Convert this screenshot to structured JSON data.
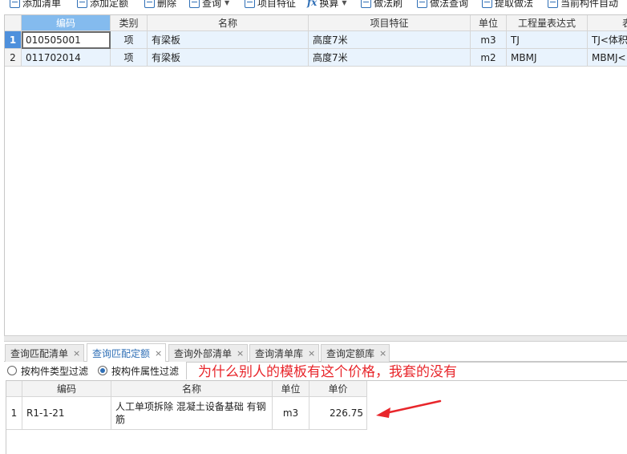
{
  "toolbar": {
    "items": [
      {
        "label": "添加清单",
        "icon": "add-list-icon"
      },
      {
        "label": "添加定额",
        "icon": "add-quota-icon"
      },
      {
        "label": "删除",
        "icon": "delete-icon"
      },
      {
        "label": "查询",
        "icon": "query-icon"
      },
      {
        "label": "项目特征",
        "icon": "feature-icon"
      },
      {
        "label": "换算",
        "icon": "fx-icon"
      },
      {
        "label": "做法刷",
        "icon": "brush-icon"
      },
      {
        "label": "做法查询",
        "icon": "method-query-icon"
      },
      {
        "label": "提取做法",
        "icon": "extract-icon"
      },
      {
        "label": "当前构件自动",
        "icon": "auto-icon"
      }
    ]
  },
  "main_grid": {
    "headers": [
      "编码",
      "类别",
      "名称",
      "项目特征",
      "单位",
      "工程量表达式",
      "表"
    ],
    "rows": [
      {
        "num": "1",
        "code": "010505001",
        "type": "项",
        "name": "有梁板",
        "feature": "高度7米",
        "unit": "m3",
        "expr": "TJ",
        "expr2": "TJ<体积"
      },
      {
        "num": "2",
        "code": "011702014",
        "type": "项",
        "name": "有梁板",
        "feature": "高度7米",
        "unit": "m2",
        "expr": "MBMJ",
        "expr2": "MBMJ<"
      }
    ]
  },
  "tabs": [
    {
      "label": "查询匹配清单",
      "active": false
    },
    {
      "label": "查询匹配定额",
      "active": true
    },
    {
      "label": "查询外部清单",
      "active": false
    },
    {
      "label": "查询清单库",
      "active": false
    },
    {
      "label": "查询定额库",
      "active": false
    }
  ],
  "filters": {
    "by_type": "按构件类型过滤",
    "by_attr": "按构件属性过滤",
    "selected": "by_attr"
  },
  "annotation": {
    "text": "为什么别人的模板有这个价格，我套的没有",
    "color": "#e8262b"
  },
  "quota_grid": {
    "headers": [
      "编码",
      "名称",
      "单位",
      "单价"
    ],
    "rows": [
      {
        "num": "1",
        "code": "R1-1-21",
        "name": "人工单项拆除 混凝土设备基础 有钢筋",
        "unit": "m3",
        "price": "226.75"
      }
    ]
  },
  "colors": {
    "header_active": "#84bbee",
    "row_highlight": "#e9f3fd",
    "row_number_selected": "#4e90dc",
    "tab_active_text": "#2f6fb6"
  }
}
